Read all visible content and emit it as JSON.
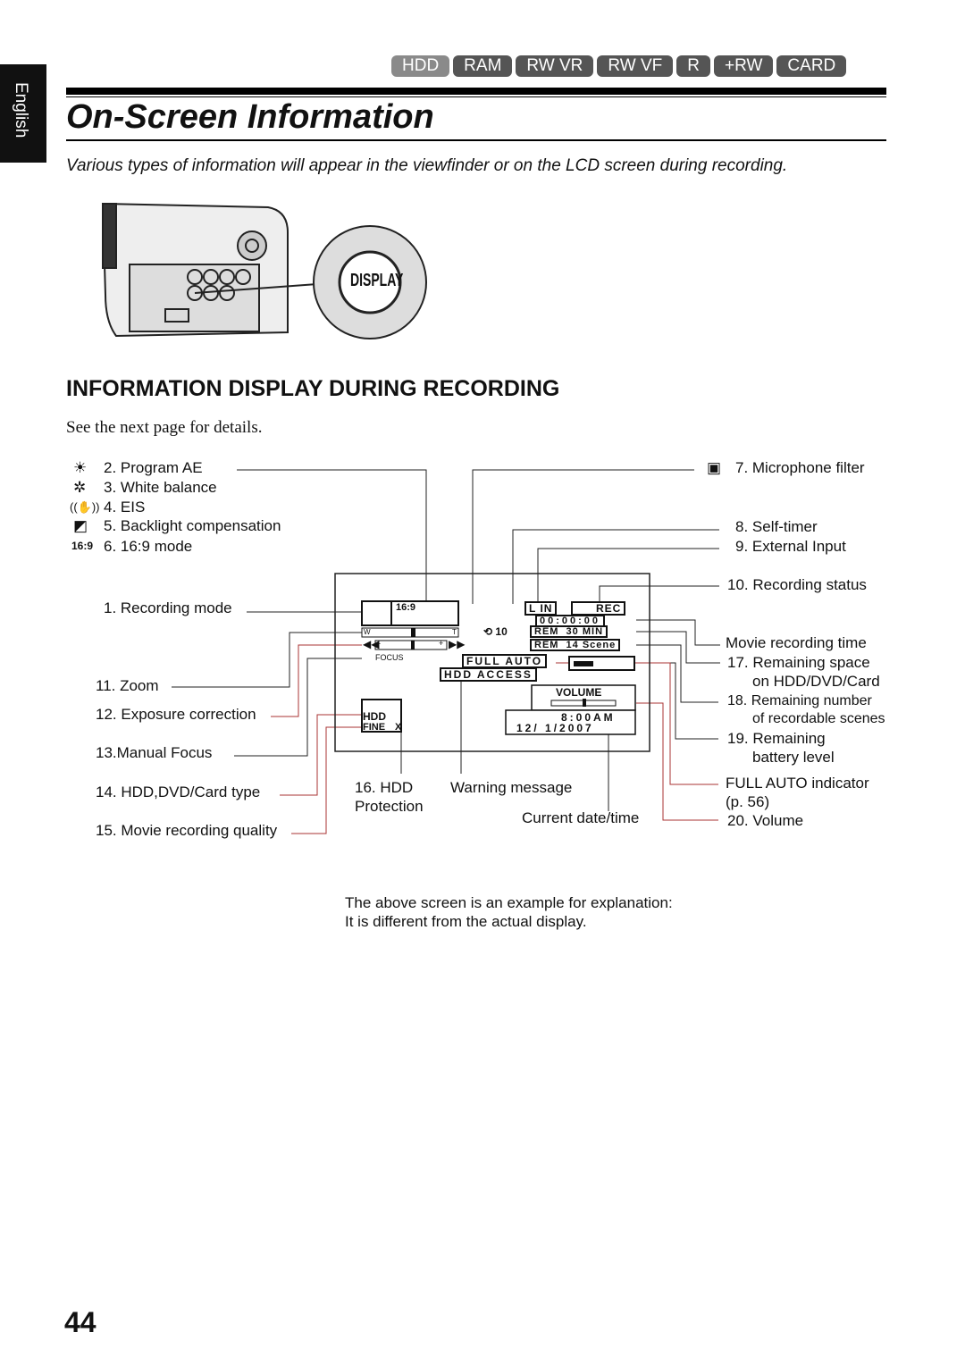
{
  "language_tab": "English",
  "media_tabs": [
    {
      "label": "HDD",
      "active": true
    },
    {
      "label": "RAM"
    },
    {
      "label": "RW VR"
    },
    {
      "label": "RW VF"
    },
    {
      "label": "R"
    },
    {
      "label": "+RW"
    },
    {
      "label": "CARD"
    }
  ],
  "title": "On-Screen Information",
  "intro": "Various types of information will appear in the viewfinder or on the LCD screen during recording.",
  "display_button": "DISPLAY",
  "section_heading": "INFORMATION DISPLAY DURING RECORDING",
  "see_next": "See the next page for details.",
  "labels": {
    "l2": "2. Program AE",
    "l3": "3. White balance",
    "l4": "4. EIS",
    "l5": "5. Backlight compensation",
    "l6": "6. 16:9 mode",
    "l1": "1. Recording mode",
    "l11": "11. Zoom",
    "l12": "12. Exposure correction",
    "l13": "13.Manual Focus",
    "l14": "14. HDD,DVD/Card type",
    "l15": "15. Movie recording quality",
    "l16a": "16. HDD",
    "l16b": "Protection",
    "warn": "Warning message",
    "date": "Current date/time",
    "l7": "7. Microphone filter",
    "l8": "8. Self-timer",
    "l9": "9. External Input",
    "l10": "10. Recording status",
    "movie_time": "Movie recording time",
    "l17a": "17. Remaining space",
    "l17b": "on HDD/DVD/Card",
    "l18a": "18. Remaining number",
    "l18b": "of recordable scenes",
    "l19a": "19. Remaining",
    "l19b": "battery level",
    "fa_a": "FULL AUTO indicator",
    "fa_b": "(p. 56)",
    "l20": "20. Volume"
  },
  "osd": {
    "aspect": "16:9",
    "w": "W",
    "t": "T",
    "minus": "-",
    "plus": "+",
    "focus": "FOCUS",
    "lin": "L IN",
    "rec": "REC",
    "time": "00:00:00",
    "timer": "10",
    "rem_min": "REM  30 MIN",
    "rem_scene": "REM  14 Scene",
    "full_auto": "FULL AUTO",
    "hdd_access": "HDD ACCESS",
    "volume": "VOLUME",
    "clock": "8:00AM",
    "date": "12/ 1/2007",
    "media": "HDD",
    "quality": "FINE",
    "protect": "X"
  },
  "caption": [
    "The above screen is an example for explanation:",
    "It is different from the actual display."
  ],
  "page_number": "44"
}
